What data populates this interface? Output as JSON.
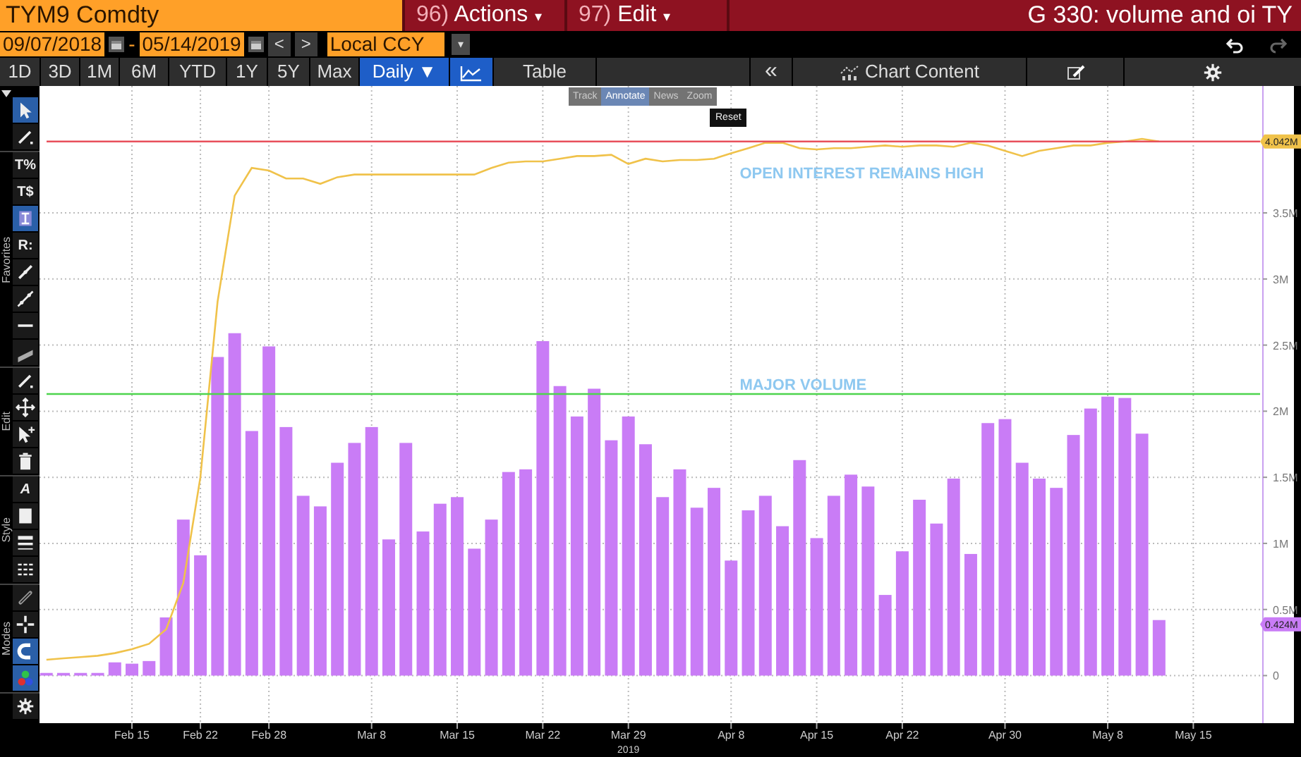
{
  "header": {
    "security": "TYM9 Comdty",
    "menus": [
      {
        "number": "96)",
        "label": "Actions",
        "caret": "▾"
      },
      {
        "number": "97)",
        "label": "Edit",
        "caret": "▾"
      }
    ],
    "title": "G 330: volume and oi TY"
  },
  "date_range": {
    "start": "09/07/2018",
    "separator": "-",
    "end": "05/14/2019",
    "currency": "Local CCY",
    "dropdown": "▾",
    "prev": "<",
    "next": ">"
  },
  "periods": [
    {
      "label": "1D",
      "selected": false
    },
    {
      "label": "3D",
      "selected": false
    },
    {
      "label": "1M",
      "selected": false
    },
    {
      "label": "6M",
      "selected": false
    },
    {
      "label": "YTD",
      "selected": false
    },
    {
      "label": "1Y",
      "selected": false
    },
    {
      "label": "5Y",
      "selected": false
    },
    {
      "label": "Max",
      "selected": false
    }
  ],
  "frequency": "Daily ▼",
  "table_button": "Table",
  "collapse_button": "«",
  "chart_content": "Chart Content",
  "tool_groups": [
    {
      "items": [
        {
          "selected": true
        },
        {
          "selected": false
        }
      ]
    },
    {
      "label": "Favorites",
      "items": [
        {
          "glyph": "T%",
          "selected": false
        },
        {
          "glyph": "T$",
          "selected": false
        },
        {
          "selected": true
        },
        {
          "glyph": "R:",
          "selected": false
        },
        {
          "selected": false
        },
        {
          "selected": false
        },
        {
          "selected": false
        },
        {
          "selected": false
        }
      ]
    },
    {
      "label": "Edit",
      "items": [
        {
          "selected": false
        },
        {
          "selected": false
        },
        {
          "selected": false
        },
        {
          "selected": false
        }
      ]
    },
    {
      "label": "Style",
      "items": [
        {
          "glyph": "A",
          "selected": false
        },
        {
          "selected": false
        },
        {
          "selected": false
        },
        {
          "selected": false
        }
      ]
    },
    {
      "label": "Modes",
      "items": [
        {
          "selected": false
        },
        {
          "selected": false
        },
        {
          "selected": true
        },
        {
          "selected": true
        }
      ]
    }
  ],
  "chart_toolbar": [
    {
      "label": "Track",
      "selected": false
    },
    {
      "label": "Annotate",
      "selected": true
    },
    {
      "label": "News",
      "selected": false
    },
    {
      "label": "Zoom",
      "selected": false
    }
  ],
  "reset": "Reset",
  "chart": {
    "chart_data": {
      "type": "bar",
      "xlabel": "2019",
      "categories": [
        null,
        null,
        null,
        null,
        null,
        "Feb 15",
        null,
        null,
        null,
        "Feb 22",
        null,
        null,
        null,
        "Feb 28",
        null,
        null,
        null,
        null,
        null,
        "Mar 8",
        null,
        null,
        null,
        null,
        "Mar 15",
        null,
        null,
        null,
        null,
        "Mar 22",
        null,
        null,
        null,
        null,
        "Mar 29",
        null,
        null,
        null,
        null,
        null,
        "Apr 8",
        null,
        null,
        null,
        null,
        "Apr 15",
        null,
        null,
        null,
        null,
        "Apr 22",
        null,
        null,
        null,
        null,
        null,
        "Apr 30",
        null,
        null,
        null,
        null,
        null,
        "May 8",
        null,
        null,
        null,
        null,
        "May 15"
      ],
      "series": [
        {
          "color": "#c97cf6",
          "values": [
            0.02,
            0.02,
            0.02,
            0.02,
            0.1,
            0.09,
            0.11,
            0.44,
            1.18,
            0.91,
            2.41,
            2.59,
            1.85,
            2.49,
            1.88,
            1.36,
            1.28,
            1.61,
            1.76,
            1.88,
            1.03,
            1.76,
            1.09,
            1.3,
            1.35,
            0.96,
            1.18,
            1.54,
            1.56,
            2.53,
            2.19,
            1.96,
            2.17,
            1.78,
            1.96,
            1.75,
            1.35,
            1.56,
            1.27,
            1.42,
            0.87,
            1.25,
            1.36,
            1.13,
            1.63,
            1.04,
            1.36,
            1.52,
            1.43,
            0.61,
            0.94,
            1.33,
            1.15,
            1.49,
            0.92,
            1.91,
            1.94,
            1.61,
            1.49,
            1.42,
            1.82,
            2.02,
            2.11,
            2.1,
            1.83,
            0.42,
            null,
            null
          ]
        },
        {
          "type": "line",
          "color": "#f0c24a",
          "values": [
            0.12,
            0.13,
            0.14,
            0.15,
            0.17,
            0.2,
            0.24,
            0.35,
            0.7,
            1.5,
            2.83,
            3.63,
            3.84,
            3.82,
            3.76,
            3.76,
            3.72,
            3.77,
            3.79,
            3.79,
            3.79,
            3.79,
            3.79,
            3.79,
            3.79,
            3.79,
            3.84,
            3.88,
            3.89,
            3.89,
            3.91,
            3.93,
            3.93,
            3.94,
            3.87,
            3.91,
            3.89,
            3.9,
            3.9,
            3.91,
            3.95,
            3.99,
            4.03,
            4.03,
            3.99,
            3.98,
            3.99,
            3.99,
            4.0,
            4.01,
            4.0,
            4.01,
            4.01,
            4.0,
            4.03,
            4.01,
            3.97,
            3.93,
            3.97,
            3.99,
            4.01,
            4.01,
            4.03,
            4.04,
            4.06,
            4.04,
            null,
            null
          ]
        }
      ],
      "ylim": [
        -0.36,
        4.46
      ],
      "grid": true,
      "yticks": [
        {
          "value": 0,
          "label": "0"
        },
        {
          "value": 0.5,
          "label": "0.5M"
        },
        {
          "value": 1,
          "label": "1M"
        },
        {
          "value": 1.5,
          "label": "1.5M"
        },
        {
          "value": 2,
          "label": "2M"
        },
        {
          "value": 2.5,
          "label": "2.5M"
        },
        {
          "value": 3,
          "label": "3M"
        },
        {
          "value": 3.5,
          "label": "3.5M"
        }
      ],
      "ref_lines": [
        {
          "axis": "y",
          "value": 4.04,
          "color": "#e8505b"
        },
        {
          "axis": "y",
          "value": 2.13,
          "color": "#4dd44d"
        }
      ],
      "annotations": [
        "OPEN INTEREST REMAINS HIGH",
        "MAJOR VOLUME",
        "4.042M",
        "0.424M"
      ]
    }
  }
}
